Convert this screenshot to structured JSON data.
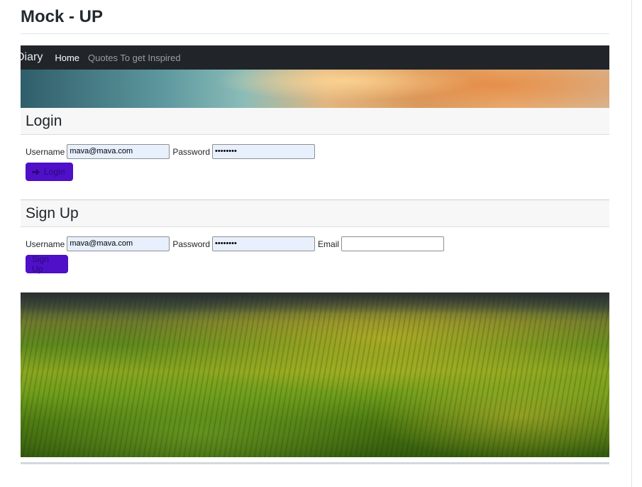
{
  "page": {
    "title": "Mock - UP"
  },
  "navbar": {
    "brand": "Diary",
    "links": [
      {
        "label": "Home",
        "active": true
      },
      {
        "label": "Quotes To get Inspired",
        "active": false
      }
    ]
  },
  "login": {
    "heading": "Login",
    "username_label": "Username",
    "username_value": "mava@mava.com",
    "password_label": "Password",
    "password_value": "••••••••",
    "button_label": "Login",
    "button_icon": "sign-in-icon"
  },
  "signup": {
    "heading": "Sign Up",
    "username_label": "Username",
    "username_value": "mava@mava.com",
    "password_label": "Password",
    "password_value": "••••••••",
    "email_label": "Email",
    "email_value": "",
    "button_label": "Sign Up"
  },
  "colors": {
    "navbar": "#212529",
    "button": "#4f10c8",
    "autofill": "#e8f0fe"
  }
}
